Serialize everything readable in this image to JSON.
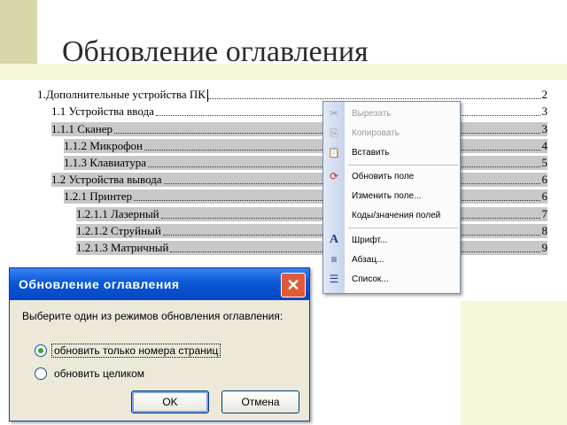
{
  "slide": {
    "title": "Обновление оглавления"
  },
  "toc": {
    "entries": [
      {
        "text": "1.Дополнительные устройства ПК",
        "page": "2",
        "level": 0,
        "highlighted": false,
        "cursor": true
      },
      {
        "text": "1.1 Устройства ввода",
        "page": "3",
        "level": 1,
        "highlighted": false,
        "cursor": false
      },
      {
        "text": "1.1.1 Сканер",
        "page": "3",
        "level": 1,
        "highlighted": true,
        "cursor": false
      },
      {
        "text": "1.1.2 Микрофон",
        "page": "4",
        "level": 2,
        "highlighted": true,
        "cursor": false
      },
      {
        "text": "1.1.3 Клавиатура",
        "page": "5",
        "level": 2,
        "highlighted": true,
        "cursor": false
      },
      {
        "text": "1.2 Устройства вывода",
        "page": "6",
        "level": 1,
        "highlighted": true,
        "cursor": false
      },
      {
        "text": "1.2.1 Принтер",
        "page": "6",
        "level": 2,
        "highlighted": true,
        "cursor": false
      },
      {
        "text": "1.2.1.1 Лазерный",
        "page": "7",
        "level": 3,
        "highlighted": true,
        "cursor": false
      },
      {
        "text": "1.2.1.2 Струйный",
        "page": "8",
        "level": 3,
        "highlighted": true,
        "cursor": false
      },
      {
        "text": "1.2.1.3 Матричный",
        "page": "9",
        "level": 3,
        "highlighted": true,
        "cursor": false
      }
    ]
  },
  "context_menu": {
    "items": [
      {
        "label": "Вырезать",
        "icon": "scissors-icon",
        "glyph": "✂",
        "disabled": true
      },
      {
        "label": "Копировать",
        "icon": "copy-icon",
        "glyph": "⎘",
        "disabled": true
      },
      {
        "label": "Вставить",
        "icon": "paste-icon",
        "glyph": "📋",
        "disabled": false
      },
      {
        "label": "Обновить поле",
        "icon": "update-field-icon",
        "glyph": "⟳",
        "disabled": false
      },
      {
        "label": "Изменить поле...",
        "icon": "",
        "glyph": "",
        "disabled": false
      },
      {
        "label": "Коды/значения полей",
        "icon": "",
        "glyph": "",
        "disabled": false
      },
      {
        "label": "Шрифт...",
        "icon": "font-icon",
        "glyph": "A",
        "disabled": false
      },
      {
        "label": "Абзац...",
        "icon": "paragraph-icon",
        "glyph": "≡",
        "disabled": false
      },
      {
        "label": "Список...",
        "icon": "list-icon",
        "glyph": "☰",
        "disabled": false
      }
    ]
  },
  "dialog": {
    "title": "Обновление оглавления",
    "prompt": "Выберите один из режимов обновления оглавления:",
    "options": [
      {
        "label": "обновить только номера страниц",
        "checked": true
      },
      {
        "label": "обновить целиком",
        "checked": false
      }
    ],
    "ok_label": "OK",
    "cancel_label": "Отмена",
    "close_glyph": "✕"
  },
  "colors": {
    "accent": "#d6d7a4",
    "dialog_title": "#0a58d8",
    "close_button": "#e05a3a",
    "highlight": "#c8c8c8"
  }
}
